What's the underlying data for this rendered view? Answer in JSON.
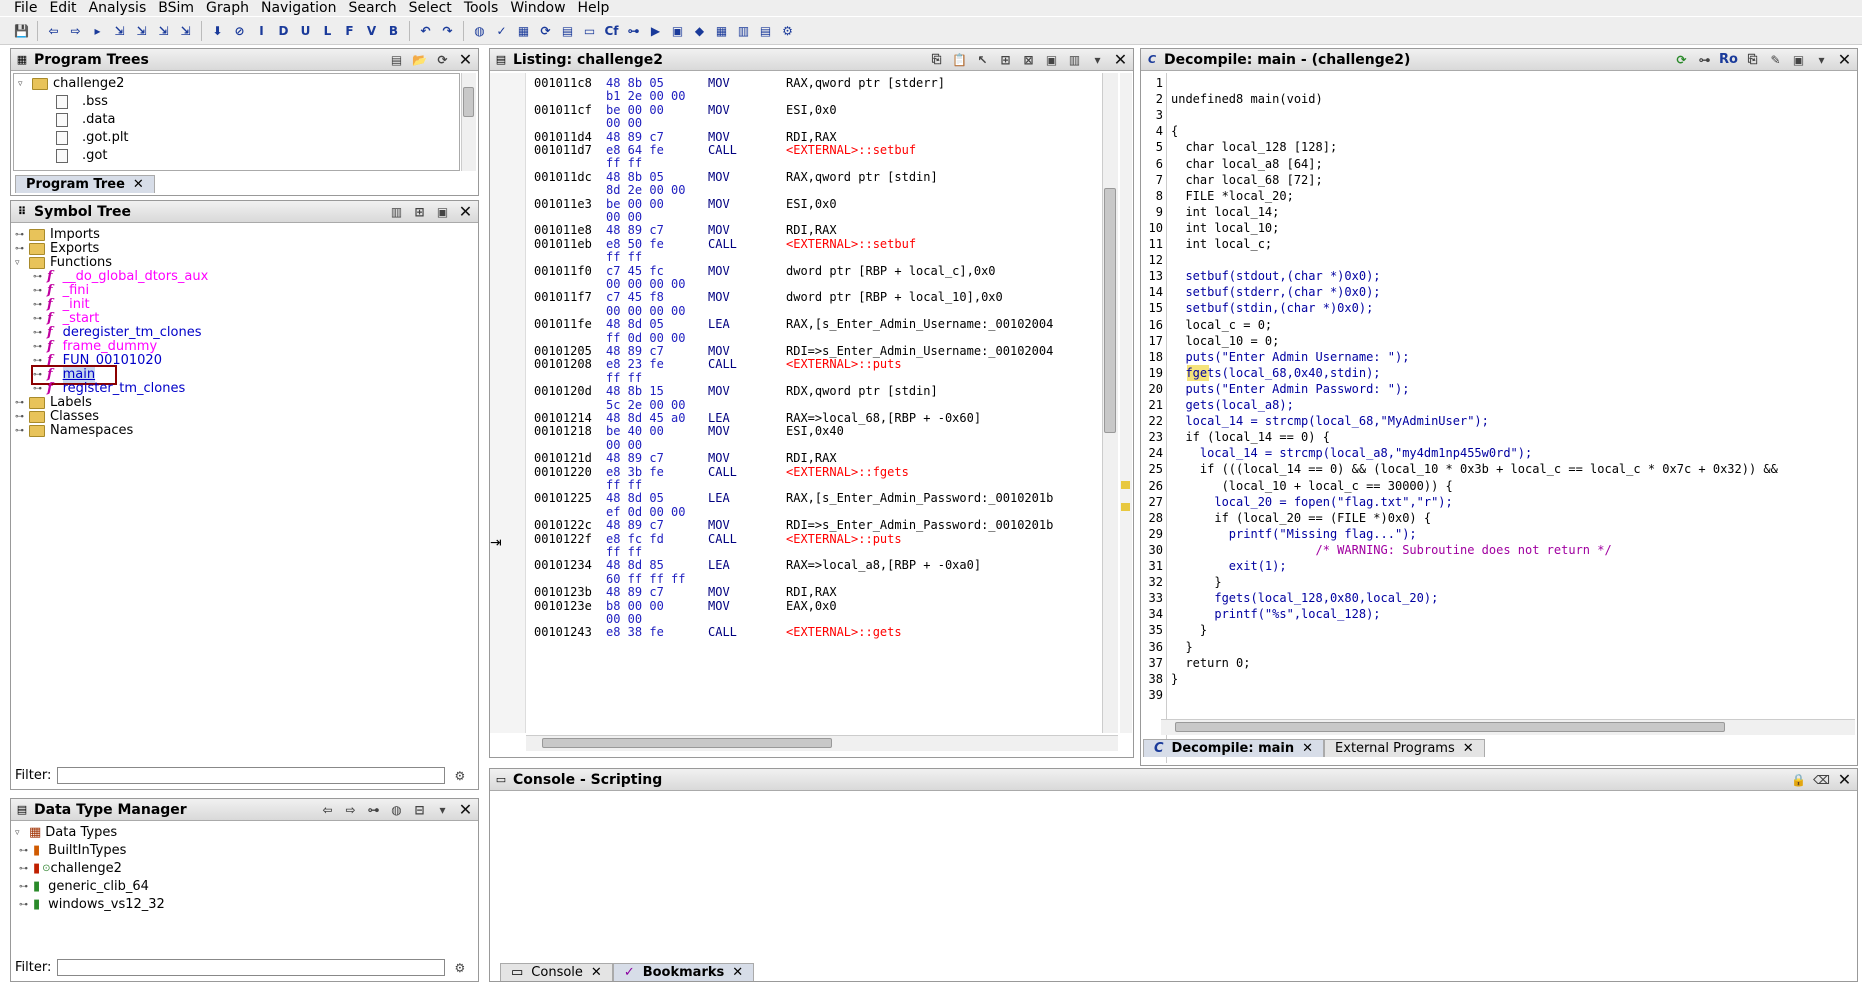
{
  "menubar": [
    "File",
    "Edit",
    "Analysis",
    "BSim",
    "Graph",
    "Navigation",
    "Search",
    "Select",
    "Tools",
    "Window",
    "Help"
  ],
  "toolbar": {
    "icons": [
      "save-icon",
      "back-icon",
      "forward-icon",
      "next-selection-icon",
      "nav1-icon",
      "nav2-icon",
      "nav3-icon",
      "nav4-icon",
      "down-arrow-icon",
      "stop-icon",
      "I",
      "D",
      "U",
      "L",
      "F",
      "V",
      "B",
      "undo-icon",
      "redo-icon",
      "globe-icon",
      "checkmark-icon",
      "calculator-icon",
      "refresh-icon",
      "table-icon",
      "folder-icon",
      "cf-icon",
      "graph-icon",
      "run-icon",
      "terminal-icon",
      "diamond-icon",
      "grid-icon",
      "memory-icon",
      "stack-icon",
      "plugin-icon"
    ]
  },
  "program_trees": {
    "title": "Program Trees",
    "root": "challenge2",
    "items": [
      ".bss",
      ".data",
      ".got.plt",
      ".got"
    ],
    "tab_label": "Program Tree"
  },
  "symbol_tree": {
    "title": "Symbol Tree",
    "top_items": [
      "Imports",
      "Exports",
      "Functions"
    ],
    "functions": [
      {
        "name": "__do_global_dtors_aux",
        "color": "#ff00ff"
      },
      {
        "name": "_fini",
        "color": "#ff00ff"
      },
      {
        "name": "_init",
        "color": "#ff00ff"
      },
      {
        "name": "_start",
        "color": "#ff00ff"
      },
      {
        "name": "deregister_tm_clones",
        "color": "#0000c8"
      },
      {
        "name": "frame_dummy",
        "color": "#ff00ff"
      },
      {
        "name": "FUN_00101020",
        "color": "#0000c8"
      },
      {
        "name": "main",
        "color": "#0000c8"
      },
      {
        "name": "register_tm_clones",
        "color": "#0000c8"
      }
    ],
    "bottom_items": [
      "Labels",
      "Classes",
      "Namespaces"
    ],
    "filter_label": "Filter:"
  },
  "data_type_manager": {
    "title": "Data Type Manager",
    "root": "Data Types",
    "items": [
      "BuiltInTypes",
      "challenge2",
      "generic_clib_64",
      "windows_vs12_32"
    ],
    "filter_label": "Filter:"
  },
  "listing": {
    "title": "Listing:  challenge2",
    "rows": [
      {
        "addr": "001011c8",
        "bytes": "48 8b 05",
        "mnem": "MOV",
        "ops": "RAX,qword ptr [stderr]"
      },
      {
        "addr": "",
        "bytes": "b1 2e 00 00",
        "mnem": "",
        "ops": ""
      },
      {
        "addr": "001011cf",
        "bytes": "be 00 00",
        "mnem": "MOV",
        "ops": "ESI,0x0"
      },
      {
        "addr": "",
        "bytes": "00 00",
        "mnem": "",
        "ops": ""
      },
      {
        "addr": "001011d4",
        "bytes": "48 89 c7",
        "mnem": "MOV",
        "ops": "RDI,RAX"
      },
      {
        "addr": "001011d7",
        "bytes": "e8 64 fe",
        "mnem": "CALL",
        "ops": "<EXTERNAL>::setbuf"
      },
      {
        "addr": "",
        "bytes": "ff ff",
        "mnem": "",
        "ops": ""
      },
      {
        "addr": "001011dc",
        "bytes": "48 8b 05",
        "mnem": "MOV",
        "ops": "RAX,qword ptr [stdin]"
      },
      {
        "addr": "",
        "bytes": "8d 2e 00 00",
        "mnem": "",
        "ops": ""
      },
      {
        "addr": "001011e3",
        "bytes": "be 00 00",
        "mnem": "MOV",
        "ops": "ESI,0x0"
      },
      {
        "addr": "",
        "bytes": "00 00",
        "mnem": "",
        "ops": ""
      },
      {
        "addr": "001011e8",
        "bytes": "48 89 c7",
        "mnem": "MOV",
        "ops": "RDI,RAX"
      },
      {
        "addr": "001011eb",
        "bytes": "e8 50 fe",
        "mnem": "CALL",
        "ops": "<EXTERNAL>::setbuf"
      },
      {
        "addr": "",
        "bytes": "ff ff",
        "mnem": "",
        "ops": ""
      },
      {
        "addr": "001011f0",
        "bytes": "c7 45 fc",
        "mnem": "MOV",
        "ops": "dword ptr [RBP + local_c],0x0"
      },
      {
        "addr": "",
        "bytes": "00 00 00 00",
        "mnem": "",
        "ops": ""
      },
      {
        "addr": "001011f7",
        "bytes": "c7 45 f8",
        "mnem": "MOV",
        "ops": "dword ptr [RBP + local_10],0x0"
      },
      {
        "addr": "",
        "bytes": "00 00 00 00",
        "mnem": "",
        "ops": ""
      },
      {
        "addr": "001011fe",
        "bytes": "48 8d 05",
        "mnem": "LEA",
        "ops": "RAX,[s_Enter_Admin_Username:_00102004"
      },
      {
        "addr": "",
        "bytes": "ff 0d 00 00",
        "mnem": "",
        "ops": ""
      },
      {
        "addr": "00101205",
        "bytes": "48 89 c7",
        "mnem": "MOV",
        "ops": "RDI=>s_Enter_Admin_Username:_00102004"
      },
      {
        "addr": "00101208",
        "bytes": "e8 23 fe",
        "mnem": "CALL",
        "ops": "<EXTERNAL>::puts"
      },
      {
        "addr": "",
        "bytes": "ff ff",
        "mnem": "",
        "ops": ""
      },
      {
        "addr": "0010120d",
        "bytes": "48 8b 15",
        "mnem": "MOV",
        "ops": "RDX,qword ptr [stdin]"
      },
      {
        "addr": "",
        "bytes": "5c 2e 00 00",
        "mnem": "",
        "ops": ""
      },
      {
        "addr": "00101214",
        "bytes": "48 8d 45 a0",
        "mnem": "LEA",
        "ops": "RAX=>local_68,[RBP + -0x60]"
      },
      {
        "addr": "00101218",
        "bytes": "be 40 00",
        "mnem": "MOV",
        "ops": "ESI,0x40"
      },
      {
        "addr": "",
        "bytes": "00 00",
        "mnem": "",
        "ops": ""
      },
      {
        "addr": "0010121d",
        "bytes": "48 89 c7",
        "mnem": "MOV",
        "ops": "RDI,RAX"
      },
      {
        "addr": "00101220",
        "bytes": "e8 3b fe",
        "mnem": "CALL",
        "ops": "<EXTERNAL>::fgets"
      },
      {
        "addr": "",
        "bytes": "ff ff",
        "mnem": "",
        "ops": ""
      },
      {
        "addr": "00101225",
        "bytes": "48 8d 05",
        "mnem": "LEA",
        "ops": "RAX,[s_Enter_Admin_Password:_0010201b"
      },
      {
        "addr": "",
        "bytes": "ef 0d 00 00",
        "mnem": "",
        "ops": ""
      },
      {
        "addr": "0010122c",
        "bytes": "48 89 c7",
        "mnem": "MOV",
        "ops": "RDI=>s_Enter_Admin_Password:_0010201b"
      },
      {
        "addr": "0010122f",
        "bytes": "e8 fc fd",
        "mnem": "CALL",
        "ops": "<EXTERNAL>::puts"
      },
      {
        "addr": "",
        "bytes": "ff ff",
        "mnem": "",
        "ops": ""
      },
      {
        "addr": "00101234",
        "bytes": "48 8d 85",
        "mnem": "LEA",
        "ops": "RAX=>local_a8,[RBP + -0xa0]"
      },
      {
        "addr": "",
        "bytes": "60 ff ff ff",
        "mnem": "",
        "ops": ""
      },
      {
        "addr": "0010123b",
        "bytes": "48 89 c7",
        "mnem": "MOV",
        "ops": "RDI,RAX"
      },
      {
        "addr": "0010123e",
        "bytes": "b8 00 00",
        "mnem": "MOV",
        "ops": "EAX,0x0"
      },
      {
        "addr": "",
        "bytes": "00 00",
        "mnem": "",
        "ops": ""
      },
      {
        "addr": "00101243",
        "bytes": "e8 38 fe",
        "mnem": "CALL",
        "ops": "<EXTERNAL>::gets"
      }
    ]
  },
  "decompile": {
    "title": "Decompile: main -  (challenge2)",
    "header_badge": "Ro",
    "lines": [
      "",
      "undefined8 main(void)",
      "",
      "{",
      "  char local_128 [128];",
      "  char local_a8 [64];",
      "  char local_68 [72];",
      "  FILE *local_20;",
      "  int local_14;",
      "  int local_10;",
      "  int local_c;",
      "",
      "  setbuf(stdout,(char *)0x0);",
      "  setbuf(stderr,(char *)0x0);",
      "  setbuf(stdin,(char *)0x0);",
      "  local_c = 0;",
      "  local_10 = 0;",
      "  puts(\"Enter Admin Username: \");",
      "  fgets(local_68,0x40,stdin);",
      "  puts(\"Enter Admin Password: \");",
      "  gets(local_a8);",
      "  local_14 = strcmp(local_68,\"MyAdminUser\");",
      "  if (local_14 == 0) {",
      "    local_14 = strcmp(local_a8,\"my4dm1np455w0rd\");",
      "    if (((local_14 == 0) && (local_10 * 0x3b + local_c == local_c * 0x7c + 0x32)) &&",
      "       (local_10 + local_c == 30000)) {",
      "      local_20 = fopen(\"flag.txt\",\"r\");",
      "      if (local_20 == (FILE *)0x0) {",
      "        printf(\"Missing flag...\");",
      "                    /* WARNING: Subroutine does not return */",
      "        exit(1);",
      "      }",
      "      fgets(local_128,0x80,local_20);",
      "      printf(\"%s\",local_128);",
      "    }",
      "  }",
      "  return 0;",
      "}",
      ""
    ],
    "tabs": [
      "Decompile: main",
      "External Programs"
    ]
  },
  "console": {
    "title": "Console - Scripting",
    "tabs": [
      "Console",
      "Bookmarks"
    ]
  },
  "colors": {
    "external_call": "#ff0000",
    "function_magenta": "#ff00ff",
    "function_blue": "#0000c8",
    "selection_box": "#8b0000"
  }
}
